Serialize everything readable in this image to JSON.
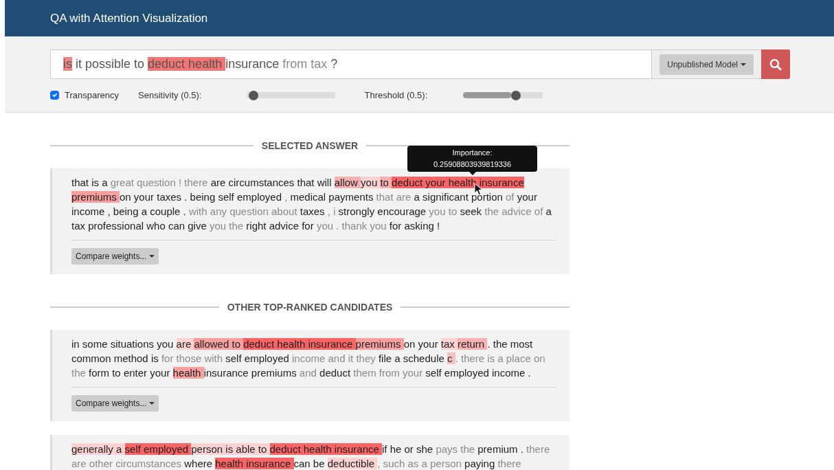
{
  "header": {
    "title": "QA with Attention Visualization"
  },
  "search": {
    "tokens": [
      {
        "text": "is",
        "color": "#f48585",
        "faded": false
      },
      {
        "text": " it possible to ",
        "faded": false
      },
      {
        "text": "deduct health ",
        "color": "#f47474",
        "faded": false
      },
      {
        "text": "insurance ",
        "faded": false
      },
      {
        "text": "from tax ",
        "faded": true
      },
      {
        "text": "?",
        "faded": false
      }
    ],
    "model_button": "Unpublished Model"
  },
  "controls": {
    "transparency": {
      "label": "Transparency",
      "checked": true
    },
    "sliders": [
      {
        "label": "Sensitivity (0.5):",
        "level": 0.02
      },
      {
        "label": "Threshold (0.5):",
        "level": 0.6
      }
    ]
  },
  "sections": [
    {
      "heading": "SELECTED ANSWER",
      "answers": [
        {
          "tokens": [
            {
              "text": "that is a ",
              "faded": false
            },
            {
              "text": "great question ! there ",
              "faded": true
            },
            {
              "text": "are circumstances that will ",
              "faded": false
            },
            {
              "text": "allow ",
              "color": "#f8b0b0",
              "faded": false
            },
            {
              "text": "you ",
              "color": "#fad2d2",
              "faded": false
            },
            {
              "text": "to ",
              "color": "#f8b0b0",
              "faded": false
            },
            {
              "text": "deduct your health insurance ",
              "color": "#fa6464",
              "faded": false
            },
            {
              "text": "premiums ",
              "color": "#f8a0a0",
              "faded": false
            },
            {
              "text": "on your taxes . being self employed ",
              "faded": false
            },
            {
              "text": ", ",
              "faded": true
            },
            {
              "text": "medical payments ",
              "faded": false
            },
            {
              "text": "that are ",
              "faded": true
            },
            {
              "text": "a significant portion ",
              "faded": false
            },
            {
              "text": "of ",
              "faded": true
            },
            {
              "text": "your income , being a couple . ",
              "faded": false
            },
            {
              "text": "with any question about ",
              "faded": true
            },
            {
              "text": "taxes ",
              "faded": false
            },
            {
              "text": ", i ",
              "faded": true
            },
            {
              "text": "strongly encourage ",
              "faded": false
            },
            {
              "text": "you to ",
              "faded": true
            },
            {
              "text": "seek ",
              "faded": false
            },
            {
              "text": "the advice of ",
              "faded": true
            },
            {
              "text": "a tax professional who can give ",
              "faded": false
            },
            {
              "text": "you the ",
              "faded": true
            },
            {
              "text": "right advice for ",
              "faded": false
            },
            {
              "text": "you . thank you ",
              "faded": true
            },
            {
              "text": "for asking !",
              "faded": false
            }
          ],
          "compare_button": "Compare weights...",
          "tooltip": {
            "title": "Importance:",
            "value": "0.25908803939819336"
          }
        }
      ]
    },
    {
      "heading": "OTHER TOP-RANKED CANDIDATES",
      "answers": [
        {
          "tokens": [
            {
              "text": "in some situations you ",
              "faded": false
            },
            {
              "text": "are ",
              "color": "#fad2d2",
              "faded": false
            },
            {
              "text": "allowed to ",
              "color": "#f8a0a0",
              "faded": false
            },
            {
              "text": "deduct health insurance ",
              "color": "#fa6464",
              "faded": false
            },
            {
              "text": "premiums ",
              "color": "#f8a0a0",
              "faded": false
            },
            {
              "text": "on your ",
              "faded": false
            },
            {
              "text": "tax ",
              "color": "#fad2d2",
              "faded": false
            },
            {
              "text": "return ",
              "color": "#f8b0b0",
              "faded": false
            },
            {
              "text": ". the most common method is ",
              "faded": false
            },
            {
              "text": "for those with ",
              "faded": true
            },
            {
              "text": "self employed ",
              "faded": false
            },
            {
              "text": "income and it they ",
              "faded": true
            },
            {
              "text": "file a schedule ",
              "faded": false
            },
            {
              "text": "c ",
              "color": "#f8c0c0",
              "faded": false
            },
            {
              "text": ". there is a place on the ",
              "faded": true
            },
            {
              "text": "form to enter your ",
              "faded": false
            },
            {
              "text": "health ",
              "color": "#f8a0a0",
              "faded": false
            },
            {
              "text": "insurance premiums ",
              "faded": false
            },
            {
              "text": "and ",
              "faded": true
            },
            {
              "text": "deduct ",
              "faded": false
            },
            {
              "text": "them from your ",
              "faded": true
            },
            {
              "text": "self employed income .",
              "faded": false
            }
          ],
          "compare_button": "Compare weights..."
        },
        {
          "tokens": [
            {
              "text": "generally a ",
              "color": "#fad2d2",
              "faded": false
            },
            {
              "text": "self employed ",
              "color": "#fa6464",
              "faded": false
            },
            {
              "text": "person is able to ",
              "color": "#fad2d2",
              "faded": false
            },
            {
              "text": "deduct health insurance ",
              "color": "#fa6464",
              "faded": false
            },
            {
              "text": "if he or she ",
              "faded": false
            },
            {
              "text": "pays the ",
              "faded": true
            },
            {
              "text": "premium . ",
              "faded": false
            },
            {
              "text": "there are other circumstances ",
              "faded": true
            },
            {
              "text": "where ",
              "faded": false
            },
            {
              "text": "health insurance ",
              "color": "#fa6464",
              "faded": false
            },
            {
              "text": "can be ",
              "faded": false
            },
            {
              "text": "deductible ",
              "color": "#fad2d2",
              "faded": false
            },
            {
              "text": ", such as a person ",
              "faded": true
            },
            {
              "text": "paying ",
              "faded": false
            },
            {
              "text": "there",
              "faded": true
            }
          ]
        }
      ]
    }
  ]
}
